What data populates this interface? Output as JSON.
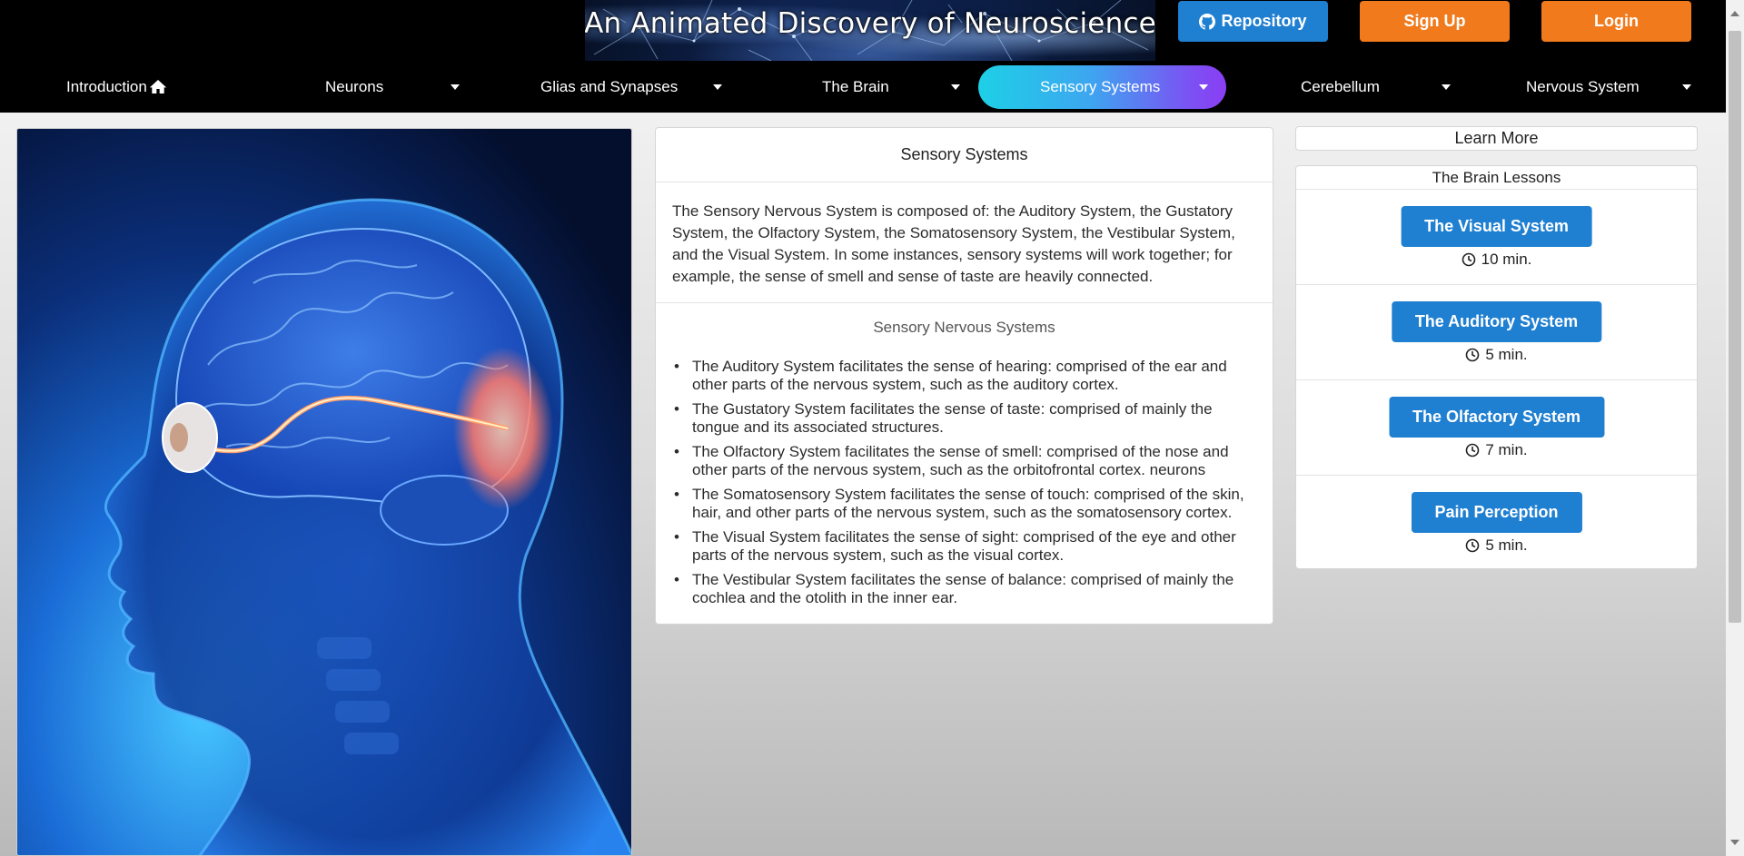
{
  "header": {
    "banner_title": "An Animated Discovery of Neuroscience",
    "repo_label": "Repository",
    "signup_label": "Sign Up",
    "login_label": "Login"
  },
  "nav": {
    "items": [
      {
        "label": "Introduction",
        "icon": "home-icon",
        "dropdown": false
      },
      {
        "label": "Neurons",
        "dropdown": true
      },
      {
        "label": "Glias and Synapses",
        "dropdown": true
      },
      {
        "label": "The Brain",
        "dropdown": true
      },
      {
        "label": "Sensory Systems",
        "dropdown": true,
        "active": true
      },
      {
        "label": "Cerebellum",
        "dropdown": true
      },
      {
        "label": "Nervous System",
        "dropdown": true
      }
    ]
  },
  "hero_image": {
    "alt_icon": "head-brain-eye-illustration"
  },
  "main": {
    "title": "Sensory Systems",
    "intro": "The Sensory Nervous System is composed of: the Auditory System, the Gustatory System, the Olfactory System, the Somatosensory System, the Vestibular System, and the Visual System. In some instances, sensory systems will work together; for example, the sense of smell and sense of taste are heavily connected.",
    "subtitle": "Sensory Nervous Systems",
    "list": [
      "The Auditory System facilitates the sense of hearing: comprised of the ear and other parts of the nervous system, such as the auditory cortex.",
      "The Gustatory System facilitates the sense of taste: comprised of mainly the tongue and its associated structures.",
      "The Olfactory System facilitates the sense of smell: comprised of the nose and other parts of the nervous system, such as the orbitofrontal cortex. neurons",
      "The Somatosensory System facilitates the sense of touch: comprised of the skin, hair, and other parts of the nervous system, such as the somatosensory cortex.",
      "The Visual System facilitates the sense of sight: comprised of the eye and other parts of the nervous system, such as the visual cortex.",
      "The Vestibular System facilitates the sense of balance: comprised of mainly the cochlea and the otolith in the inner ear."
    ]
  },
  "sidebar": {
    "learn_more": "Learn More",
    "lessons_title": "The Brain Lessons",
    "lessons": [
      {
        "label": "The Visual System",
        "time": "10 min."
      },
      {
        "label": "The Auditory System",
        "time": "5 min."
      },
      {
        "label": "The Olfactory System",
        "time": "7 min."
      },
      {
        "label": "Pain Perception",
        "time": "5 min."
      }
    ]
  },
  "colors": {
    "primary_blue": "#1f7fd1",
    "orange": "#f07a1c",
    "nav_bg": "#000000",
    "active_gradient_start": "#1dd0e6",
    "active_gradient_end": "#8a3ef3"
  }
}
